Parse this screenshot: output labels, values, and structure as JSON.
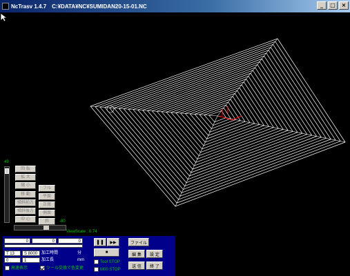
{
  "titlebar": {
    "app_name": "NcTrasv 1.4.7",
    "file_path": "C:¥DATA¥NC¥SUMIDAN20-15-01.NC",
    "minimize": "_",
    "maximize": "□",
    "close": "×"
  },
  "view_controls": {
    "zoom_value": "49",
    "buttons": [
      {
        "label": "回 転",
        "enabled": false
      },
      {
        "label": "拡 大",
        "enabled": false
      },
      {
        "label": "縮 小",
        "enabled": false
      },
      {
        "label": "移 動",
        "enabled": false
      },
      {
        "label": "傾斜前方",
        "enabled": false
      },
      {
        "label": "傾斜後方",
        "enabled": false
      },
      {
        "label": "中 心",
        "enabled": false
      }
    ],
    "view_buttons": [
      {
        "label": "フル",
        "enabled": false
      },
      {
        "label": "平面",
        "enabled": false
      },
      {
        "label": "正面",
        "enabled": false
      },
      {
        "label": "側面",
        "enabled": false
      },
      {
        "label": "斜",
        "enabled": false
      }
    ],
    "hscale_value": "-80",
    "view_scale_label": "ViewScale : 0.74"
  },
  "panel": {
    "coord_x": "0",
    "coord_y": "0",
    "coord_z": "0",
    "tool": "T 13",
    "spindle": "S 8000",
    "time_label": "加工時間",
    "time_unit": "分",
    "feed": "0",
    "length_value": "1",
    "length_label": "加工長",
    "length_unit": "mm",
    "fast_display_label": "高速表示",
    "fast_display_checked": false,
    "tool_color_label": "ツール交換で色変更",
    "tool_color_checked": true,
    "tool_stop_label": "Tool STOP",
    "tool_stop_checked": false,
    "m00_stop_label": "M00 STOP",
    "m00_stop_checked": false,
    "play_pause_icon": "❚❚",
    "fast_forward_icon": "▶▶",
    "stop_icon": "■",
    "file_button": "ファイル",
    "edit_button": "編 集",
    "settings_button": "設 定",
    "send_button": "送 信",
    "exit_button": "終 了"
  },
  "colors": {
    "panel_bg": "#00008b",
    "accent_green": "#00c800",
    "toolpath": "#ffffff",
    "origin_marker": "#ff0000"
  }
}
